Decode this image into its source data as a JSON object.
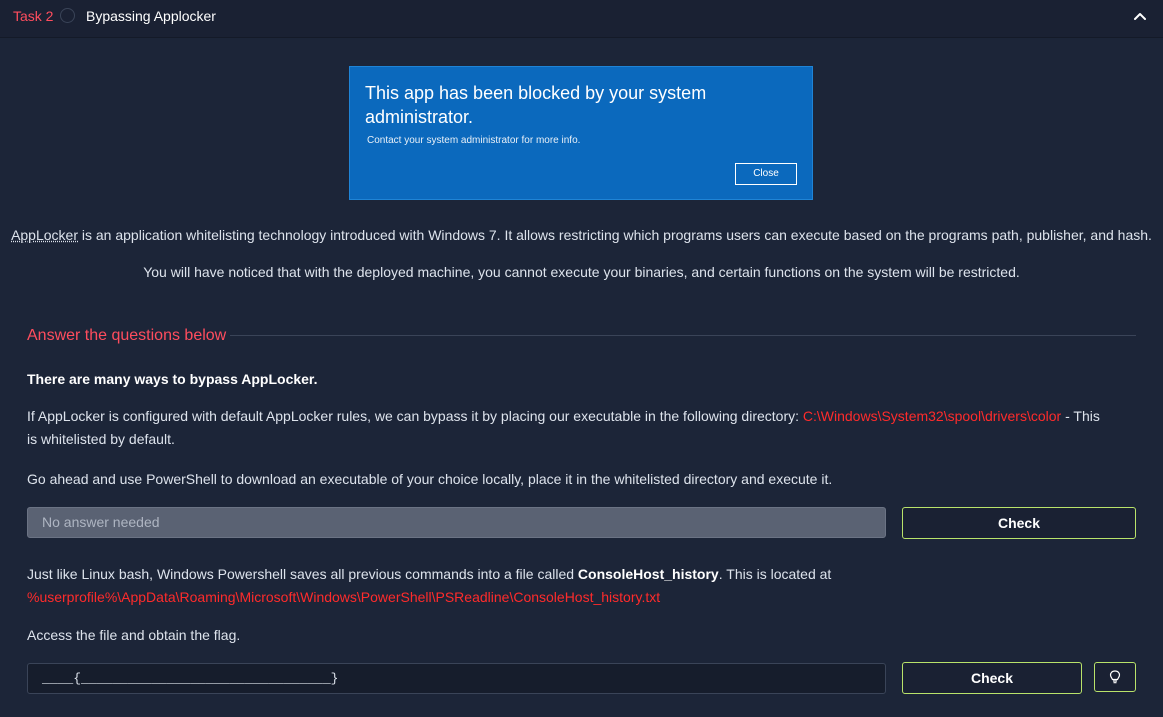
{
  "task": {
    "number": "Task 2",
    "title": "Bypassing Applocker"
  },
  "dialog": {
    "title": "This app has been blocked by your system administrator.",
    "subtitle": "Contact your system administrator for more info.",
    "close_label": "Close"
  },
  "intro": {
    "p1_term": "AppLocker",
    "p1_rest": " is an application whitelisting technology introduced with Windows 7. It allows restricting which programs users can execute based on the programs path, publisher, and hash.",
    "p2": "You will have noticed that with the deployed machine, you cannot execute your binaries, and certain functions on the system will be restricted."
  },
  "questions_header": "Answer the questions below",
  "question1": {
    "heading": "There are many ways to bypass AppLocker.",
    "text_a": "If AppLocker is configured with default AppLocker rules, we can bypass it by placing our executable in the following directory: ",
    "path": "C:\\Windows\\System32\\spool\\drivers\\color",
    "text_b": " - This is whitelisted by default.",
    "text_c": "Go ahead and use PowerShell to download an executable of your choice locally, place it in the whitelisted directory and execute it.",
    "input_placeholder": "No answer needed",
    "check_label": "Check"
  },
  "question2": {
    "text_a": "Just like Linux bash, Windows Powershell saves all previous commands into a file called ",
    "bold_file": "ConsoleHost_history",
    "text_b": ". This is located at ",
    "path": "%userprofile%\\AppData\\Roaming\\Microsoft\\Windows\\PowerShell\\PSReadline\\ConsoleHost_history.txt",
    "text_c": "Access the file and obtain the flag.",
    "input_mask": "____{________________________________}",
    "check_label": "Check",
    "hint_icon": "lightbulb-icon"
  },
  "colors": {
    "accent_red": "#ff4d5e",
    "path_red": "#ff2b2b",
    "check_border": "#b9e36a",
    "dialog_blue": "#0b69bd"
  }
}
